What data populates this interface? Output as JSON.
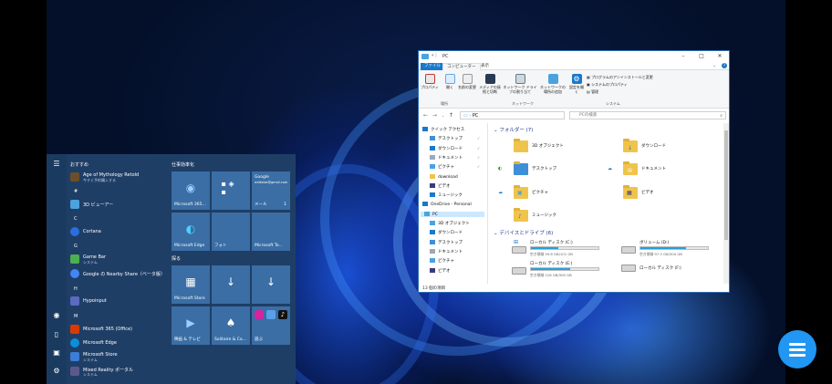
{
  "start_menu": {
    "recommended_label": "おすすめ",
    "productivity_label": "仕事効率化",
    "explore_label": "探る",
    "apps": [
      {
        "letter": "",
        "title": "Age of Mythology Retold",
        "sub": "今すぐ予約購入する",
        "icon_color": "#6b4f2a"
      },
      {
        "letter": "#",
        "title": "",
        "sub": "",
        "icon_color": ""
      },
      {
        "letter": "",
        "title": "3D ビューアー",
        "sub": "",
        "icon_color": "#4aa3df"
      },
      {
        "letter": "C",
        "title": "",
        "sub": "",
        "icon_color": ""
      },
      {
        "letter": "",
        "title": "Cortana",
        "sub": "",
        "icon_color": "#2a6fdb"
      },
      {
        "letter": "G",
        "title": "",
        "sub": "",
        "icon_color": ""
      },
      {
        "letter": "",
        "title": "Game Bar",
        "sub": "システム",
        "icon_color": "#4caf50"
      },
      {
        "letter": "",
        "title": "Google の Nearby Share（ベータ版）",
        "sub": "",
        "icon_color": "#4285f4"
      },
      {
        "letter": "H",
        "title": "",
        "sub": "",
        "icon_color": ""
      },
      {
        "letter": "",
        "title": "Hypoinput",
        "sub": "",
        "icon_color": "#5c6bc0"
      },
      {
        "letter": "M",
        "title": "",
        "sub": "",
        "icon_color": ""
      },
      {
        "letter": "",
        "title": "Microsoft 365 (Office)",
        "sub": "",
        "icon_color": "#d83b01"
      },
      {
        "letter": "",
        "title": "Microsoft Edge",
        "sub": "",
        "icon_color": "#0c8fd9"
      },
      {
        "letter": "",
        "title": "Microsoft Store",
        "sub": "システム",
        "icon_color": "#3b7dd8"
      },
      {
        "letter": "",
        "title": "Mixed Reality ポータル",
        "sub": "システム",
        "icon_color": "#5a5a8a"
      }
    ],
    "tiles": {
      "m365": "Microsoft 365...",
      "google_title": "Google",
      "google_sub": "mdkstar@gmail.com",
      "mail": "メール",
      "mail_count": "1",
      "edge": "Microsoft Edge",
      "photos": "フォト",
      "todo": "Microsoft To...",
      "store": "Microsoft Store",
      "movies": "映画 & テレビ",
      "solitaire": "Solitaire & Ca...",
      "play": "遊ぶ"
    }
  },
  "explorer": {
    "window_title": "PC",
    "tabs": [
      "ファイル",
      "コンピューター",
      "表示"
    ],
    "ribbon_buttons": [
      "プロパティ",
      "開く",
      "名前の変更",
      "メディアの接続と切断",
      "ネットワーク ドライブの割り当て",
      "ネットワークの場所の追加",
      "設定を開く"
    ],
    "ribbon_small": [
      "プログラムのアンインストールと変更",
      "システムのプロパティ",
      "管理"
    ],
    "ribbon_groups": [
      "場所",
      "ネットワーク",
      "システム"
    ],
    "address": "PC",
    "search_placeholder": "PCの検索",
    "nav_items": [
      {
        "label": "クイック アクセス",
        "icon": "star-icon",
        "pinned": false
      },
      {
        "label": "デスクトップ",
        "icon": "desktop-icon",
        "pinned": true
      },
      {
        "label": "ダウンロード",
        "icon": "download-icon",
        "pinned": true
      },
      {
        "label": "ドキュメント",
        "icon": "document-icon",
        "pinned": true
      },
      {
        "label": "ピクチャ",
        "icon": "picture-icon",
        "pinned": true
      },
      {
        "label": "download",
        "icon": "folder-icon",
        "pinned": false
      },
      {
        "label": "ビデオ",
        "icon": "video-icon",
        "pinned": false
      },
      {
        "label": "ミュージック",
        "icon": "music-icon",
        "pinned": false
      },
      {
        "label": "OneDrive - Personal",
        "icon": "cloud-icon",
        "pinned": false
      },
      {
        "label": "PC",
        "icon": "pc-icon",
        "pinned": false
      },
      {
        "label": "3D オブジェクト",
        "icon": "cube-icon",
        "pinned": false
      },
      {
        "label": "ダウンロード",
        "icon": "download-icon",
        "pinned": false
      },
      {
        "label": "デスクトップ",
        "icon": "desktop-icon",
        "pinned": false
      },
      {
        "label": "ドキュメント",
        "icon": "document-icon",
        "pinned": false
      },
      {
        "label": "ピクチャ",
        "icon": "picture-icon",
        "pinned": false
      },
      {
        "label": "ビデオ",
        "icon": "video-icon",
        "pinned": false
      }
    ],
    "folders_header": "フォルダー (7)",
    "folders": [
      "3D オブジェクト",
      "ダウンロード",
      "デスクトップ",
      "ドキュメント",
      "ピクチャ",
      "ビデオ",
      "ミュージック"
    ],
    "drives_header": "デバイスとドライブ (6)",
    "drives": [
      {
        "name": "ローカル ディスク (C:)",
        "space": "空き領域 59.8 GB/101 GB",
        "used_fraction": 0.41
      },
      {
        "name": "ボリューム (D:)",
        "space": "空き領域 97.3 GB/300 GB",
        "used_fraction": 0.68
      },
      {
        "name": "ローカル ディスク (E:)",
        "space": "空き領域 126 GB/300 GB",
        "used_fraction": 0.58
      },
      {
        "name": "ローカル ディスク (F:)",
        "space": "",
        "used_fraction": null
      }
    ],
    "status": "13 個の項目"
  }
}
